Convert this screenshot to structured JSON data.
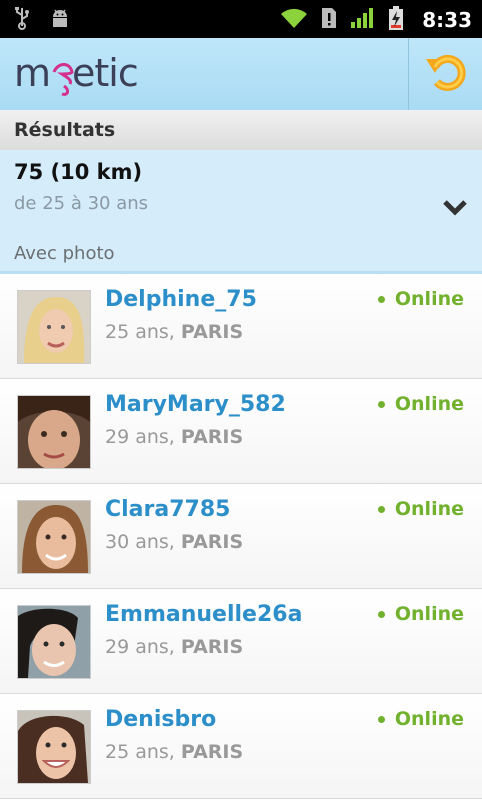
{
  "status_bar": {
    "time": "8:33",
    "icons": [
      "usb-icon",
      "android-debug-icon",
      "wifi-icon",
      "notification-icon",
      "signal-icon",
      "battery-charging-icon"
    ]
  },
  "header": {
    "logo_text": "meetic",
    "refresh_icon": "refresh-icon"
  },
  "section": {
    "title": "Résultats"
  },
  "criteria": {
    "location": "75 (10 km)",
    "age_range": "de 25 à 30 ans",
    "photo_filter": "Avec photo",
    "expand_icon": "chevron-down-icon"
  },
  "results": [
    {
      "name": "Delphine_75",
      "age": "25 ans,",
      "city": "PARIS",
      "status": "Online"
    },
    {
      "name": "MaryMary_582",
      "age": "29 ans,",
      "city": "PARIS",
      "status": "Online"
    },
    {
      "name": "Clara7785",
      "age": "30 ans,",
      "city": "PARIS",
      "status": "Online"
    },
    {
      "name": "Emmanuelle26a",
      "age": "29 ans,",
      "city": "PARIS",
      "status": "Online"
    },
    {
      "name": "Denisbro",
      "age": "25 ans,",
      "city": "PARIS",
      "status": "Online"
    }
  ],
  "colors": {
    "brand": "#3b3f58",
    "heart": "#d4308d",
    "name_link": "#2c8fc9",
    "online": "#72b12e",
    "header_bg": "#bfe6f9",
    "criteria_bg": "#d5ecfb"
  }
}
